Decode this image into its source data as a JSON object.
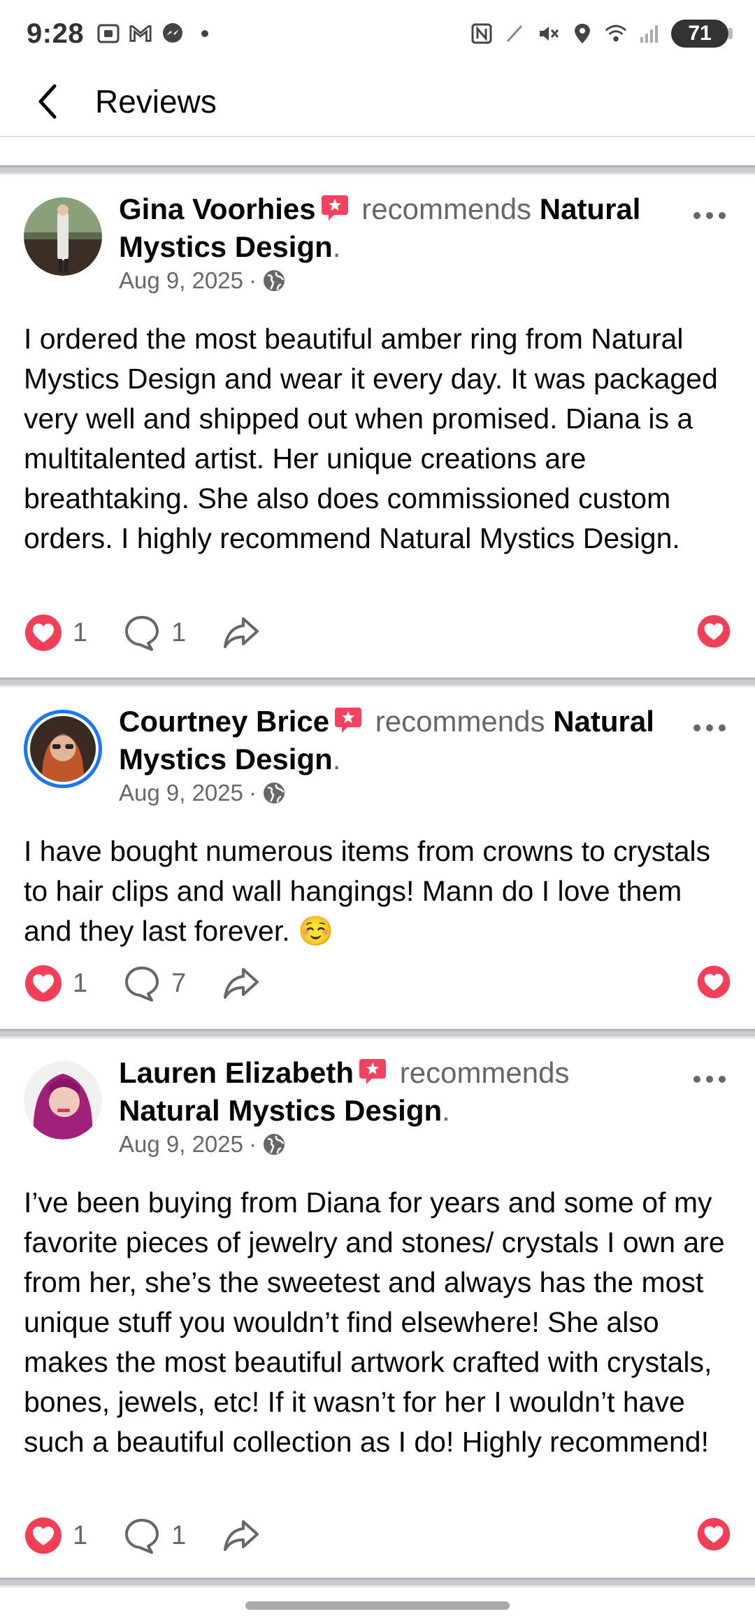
{
  "status_bar": {
    "time": "9:28",
    "left_icons": [
      "screenshot-icon",
      "gmail-icon",
      "messenger-icon",
      "dot-icon"
    ],
    "right_icons": [
      "nfc-icon",
      "stylus-icon",
      "mute-icon",
      "location-icon",
      "wifi-icon",
      "signal-icon"
    ],
    "battery": "71"
  },
  "app_bar": {
    "title": "Reviews"
  },
  "reviews": [
    {
      "name": "Gina Voorhies",
      "recommends": "recommends",
      "page": "Natural Mystics Design",
      "date": "Aug 9, 2025",
      "separator": "·",
      "text": "I ordered the most beautiful amber ring from Natural Mystics Design and wear it every day. It was packaged very well and shipped out when promised. Diana is a multitalented artist. Her unique creations are breathtaking. She also does commissioned custom orders. I highly recommend Natural Mystics Design.",
      "reactions": "1",
      "comments": "1"
    },
    {
      "name": "Courtney Brice",
      "recommends": "recommends",
      "page": "Natural Mystics Design",
      "date": "Aug 9, 2025",
      "separator": "·",
      "text": "I have bought numerous items from crowns to crystals to hair clips and wall hangings! Mann do I love them and they last forever. ☺️",
      "reactions": "1",
      "comments": "7"
    },
    {
      "name": "Lauren Elizabeth",
      "recommends": "recommends",
      "page": "Natural Mystics Design",
      "date": "Aug 9, 2025",
      "separator": "·",
      "text": "I’ve been buying from Diana for years and some of my favorite pieces of jewelry and stones/ crystals I own are from her, she’s the sweetest and always has the most unique stuff you wouldn’t find elsewhere! She also makes the most beautiful artwork crafted with crystals, bones, jewels, etc! If it wasn’t for her I wouldn’t have such a beautiful collection as I do! Highly recommend!",
      "reactions": "1",
      "comments": "1"
    }
  ],
  "colors": {
    "love": "#f33e58",
    "recommend_flag": "#f3425f",
    "secondary_text": "#65676b",
    "story_ring": "#1877f2"
  }
}
